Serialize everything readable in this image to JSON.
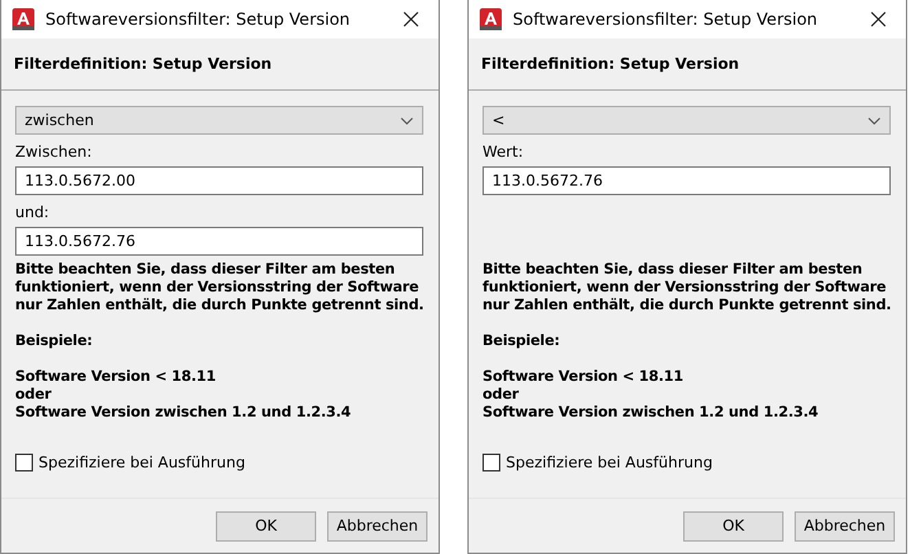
{
  "dialogs": [
    {
      "title": "Softwareversionsfilter: Setup Version",
      "heading": "Filterdefinition: Setup Version",
      "operator": "zwischen",
      "fields": [
        {
          "label": "Zwischen:",
          "value": "113.0.5672.00"
        },
        {
          "label": "und:",
          "value": "113.0.5672.76"
        }
      ],
      "note_lines": [
        "Bitte beachten Sie, dass dieser Filter am besten",
        "funktioniert, wenn der Versionsstring der Software",
        "nur Zahlen enthält, die durch Punkte getrennt sind."
      ],
      "examples_label": "Beispiele:",
      "example_lines": [
        "Software Version < 18.11",
        "oder",
        "Software Version zwischen 1.2 und 1.2.3.4"
      ],
      "checkbox": {
        "label": "Spezifiziere bei Ausführung",
        "checked": false
      },
      "buttons": [
        "OK",
        "Abbrechen"
      ]
    },
    {
      "title": "Softwareversionsfilter: Setup Version",
      "heading": "Filterdefinition: Setup Version",
      "operator": "<",
      "fields": [
        {
          "label": "Wert:",
          "value": "113.0.5672.76"
        }
      ],
      "note_lines": [
        "Bitte beachten Sie, dass dieser Filter am besten",
        "funktioniert, wenn der Versionsstring der Software",
        "nur Zahlen enthält, die durch Punkte getrennt sind."
      ],
      "examples_label": "Beispiele:",
      "example_lines": [
        "Software Version < 18.11",
        "oder",
        "Software Version zwischen 1.2 und 1.2.3.4"
      ],
      "checkbox": {
        "label": "Spezifiziere bei Ausführung",
        "checked": false
      },
      "buttons": [
        "OK",
        "Abbrechen"
      ]
    }
  ]
}
